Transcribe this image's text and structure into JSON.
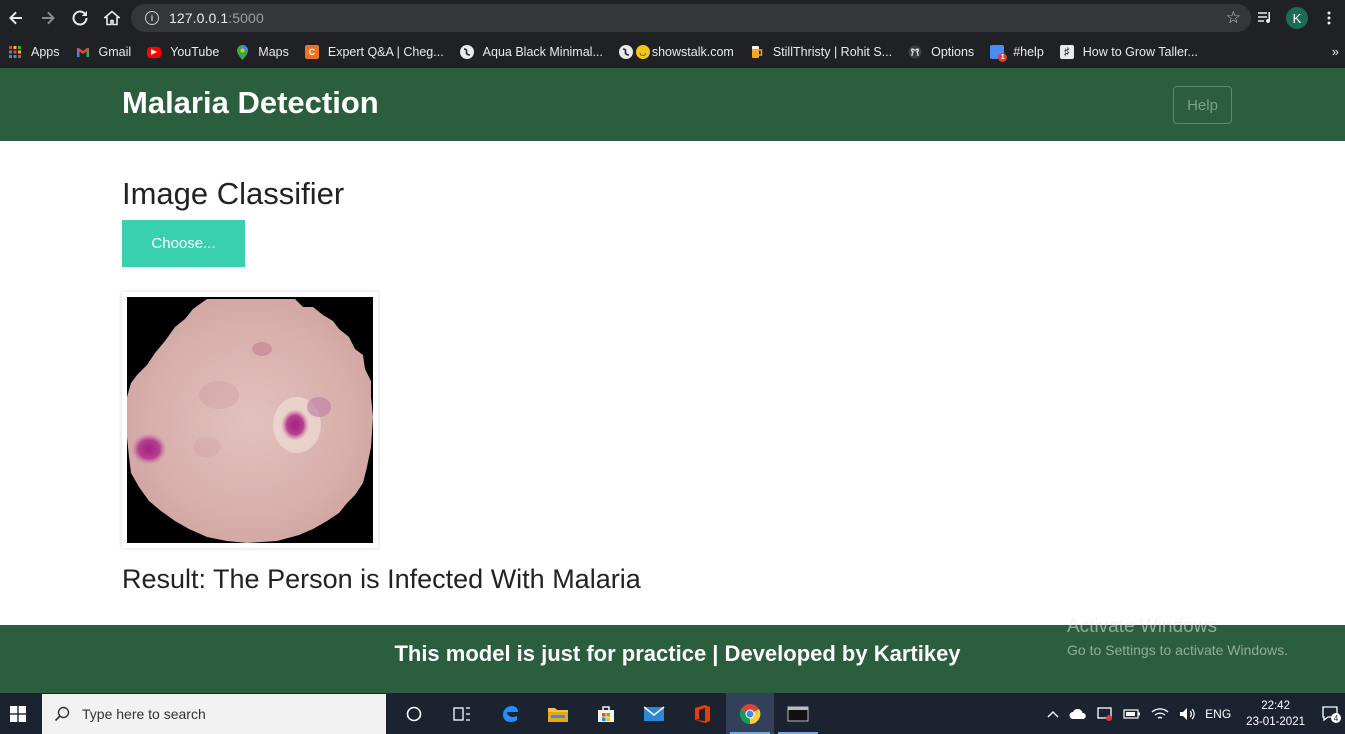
{
  "browser": {
    "url_host": "127.0.0.1",
    "url_port": ":5000",
    "profile_initial": "K",
    "bookmarks": [
      {
        "label": "Apps",
        "icon": "apps-grid-icon",
        "color": "#e8453c"
      },
      {
        "label": "Gmail",
        "icon": "gmail-icon",
        "color": "#ea4335"
      },
      {
        "label": "YouTube",
        "icon": "youtube-icon",
        "color": "#ff0000"
      },
      {
        "label": "Maps",
        "icon": "maps-icon",
        "color": "#34a853"
      },
      {
        "label": "Expert Q&A | Cheg...",
        "icon": "chegg-icon",
        "color": "#f37021"
      },
      {
        "label": "Aqua Black Minimal...",
        "icon": "globe-icon",
        "color": "#e8eaed"
      },
      {
        "label": "showstalk.com",
        "icon": "globe-icon",
        "color": "#e8eaed"
      },
      {
        "label": "StillThristy | Rohit S...",
        "icon": "beer-icon",
        "color": "#f5a623"
      },
      {
        "label": "Options",
        "icon": "github-icon",
        "color": "#e8eaed"
      },
      {
        "label": "#help",
        "icon": "help-tag-icon",
        "color": "#4a8bf5"
      },
      {
        "label": "How to Grow Taller...",
        "icon": "hashnode-icon",
        "color": "#e8eaed"
      }
    ]
  },
  "navbar": {
    "brand": "Malaria Detection",
    "help_label": "Help"
  },
  "main": {
    "title": "Image Classifier",
    "choose_label": "Choose...",
    "result": "Result: The Person is Infected With Malaria"
  },
  "footer": {
    "text": "This model is just for practice | Developed by Kartikey"
  },
  "watermark": {
    "line1": "Activate Windows",
    "line2": "Go to Settings to activate Windows."
  },
  "taskbar": {
    "search_placeholder": "Type here to search",
    "language": "ENG",
    "time": "22:42",
    "date": "23-01-2021",
    "notification_count": "4"
  },
  "colors": {
    "navbar": "#2a5e3d",
    "choose_button": "#39d0b0"
  }
}
